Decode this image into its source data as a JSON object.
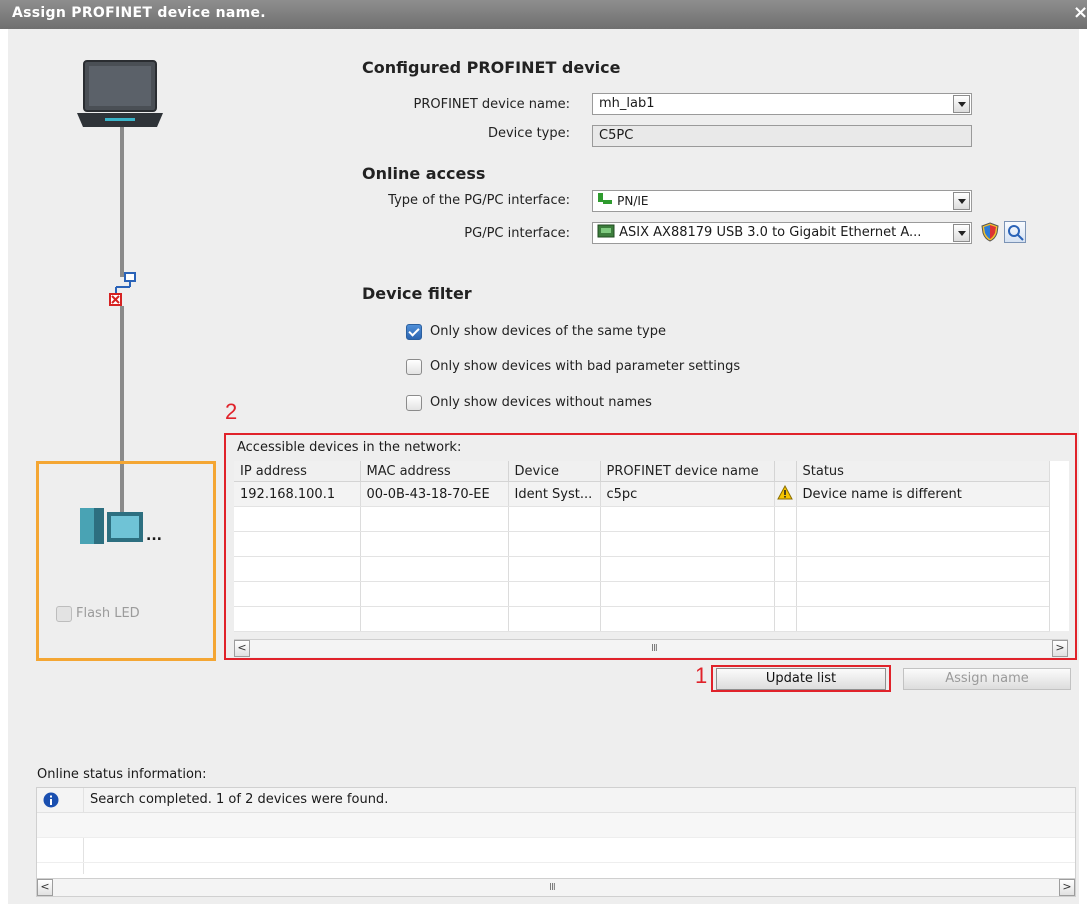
{
  "dialog": {
    "title": "Assign PROFINET device name.",
    "close_symbol": "×"
  },
  "configured": {
    "heading": "Configured PROFINET device",
    "name_label": "PROFINET device name:",
    "name_value": "mh_lab1",
    "type_label": "Device type:",
    "type_value": "C5PC"
  },
  "online": {
    "heading": "Online access",
    "iface_type_label": "Type of the PG/PC interface:",
    "iface_type_value": "PN/IE",
    "iface_label": "PG/PC interface:",
    "iface_value": "ASIX AX88179 USB 3.0 to Gigabit Ethernet A..."
  },
  "filter": {
    "heading": "Device filter",
    "options": [
      {
        "label": "Only show devices of the same type",
        "checked": true
      },
      {
        "label": "Only show devices with bad parameter settings",
        "checked": false
      },
      {
        "label": "Only show devices without names",
        "checked": false
      }
    ]
  },
  "devices": {
    "caption": "Accessible devices in the network:",
    "columns": [
      "IP address",
      "MAC address",
      "Device",
      "PROFINET device name",
      "",
      "Status"
    ],
    "rows": [
      [
        "192.168.100.1",
        "00-0B-43-18-70-EE",
        "Ident Syst...",
        "c5pc",
        "warning-icon",
        "Device name is different"
      ]
    ],
    "empty_rows": 5
  },
  "annotations": {
    "marker_1": "1",
    "marker_2": "2"
  },
  "left_panel": {
    "flash_led_label": "Flash LED",
    "device_dots": "..."
  },
  "buttons": {
    "update_list": "Update list",
    "assign_name": "Assign name"
  },
  "status": {
    "label": "Online status information:",
    "message": "Search completed. 1 of 2 devices were found."
  },
  "scroll": {
    "left": "<",
    "right": ">",
    "grip": "III"
  },
  "colors": {
    "annotation_red": "#e0222a",
    "annotation_orange": "#f4a633",
    "checkbox_blue": "#2b64b0",
    "info_blue": "#1a4fb0",
    "warning_yellow": "#f5c400"
  }
}
